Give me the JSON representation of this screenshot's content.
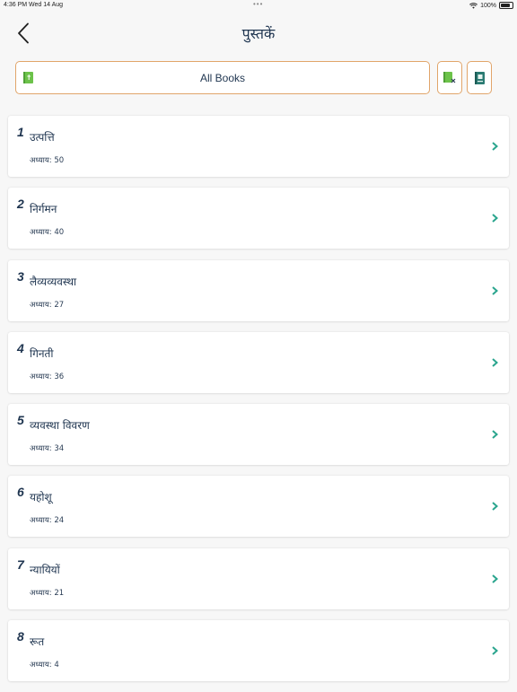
{
  "status_bar": {
    "time_date": "4:36 PM  Wed 14 Aug",
    "dots": "•••",
    "battery": "100%"
  },
  "header": {
    "title": "पुस्तकें"
  },
  "filter": {
    "label": "All Books"
  },
  "colors": {
    "accent_border": "#e1a56a",
    "chevron": "#2aa58e",
    "text": "#1f3550",
    "book_icon": "#6cc24a"
  },
  "books": [
    {
      "number": "1",
      "name": "उत्पत्ति",
      "chapters": "अध्याय: 50"
    },
    {
      "number": "2",
      "name": "निर्गमन",
      "chapters": "अध्याय: 40"
    },
    {
      "number": "3",
      "name": "लैव्यव्यवस्था",
      "chapters": "अध्याय: 27"
    },
    {
      "number": "4",
      "name": "गिनती",
      "chapters": "अध्याय: 36"
    },
    {
      "number": "5",
      "name": "व्यवस्था विवरण",
      "chapters": "अध्याय: 34"
    },
    {
      "number": "6",
      "name": "यहोशू",
      "chapters": "अध्याय: 24"
    },
    {
      "number": "7",
      "name": "न्यायियों",
      "chapters": "अध्याय: 21"
    },
    {
      "number": "8",
      "name": "रूत",
      "chapters": "अध्याय: 4"
    }
  ]
}
